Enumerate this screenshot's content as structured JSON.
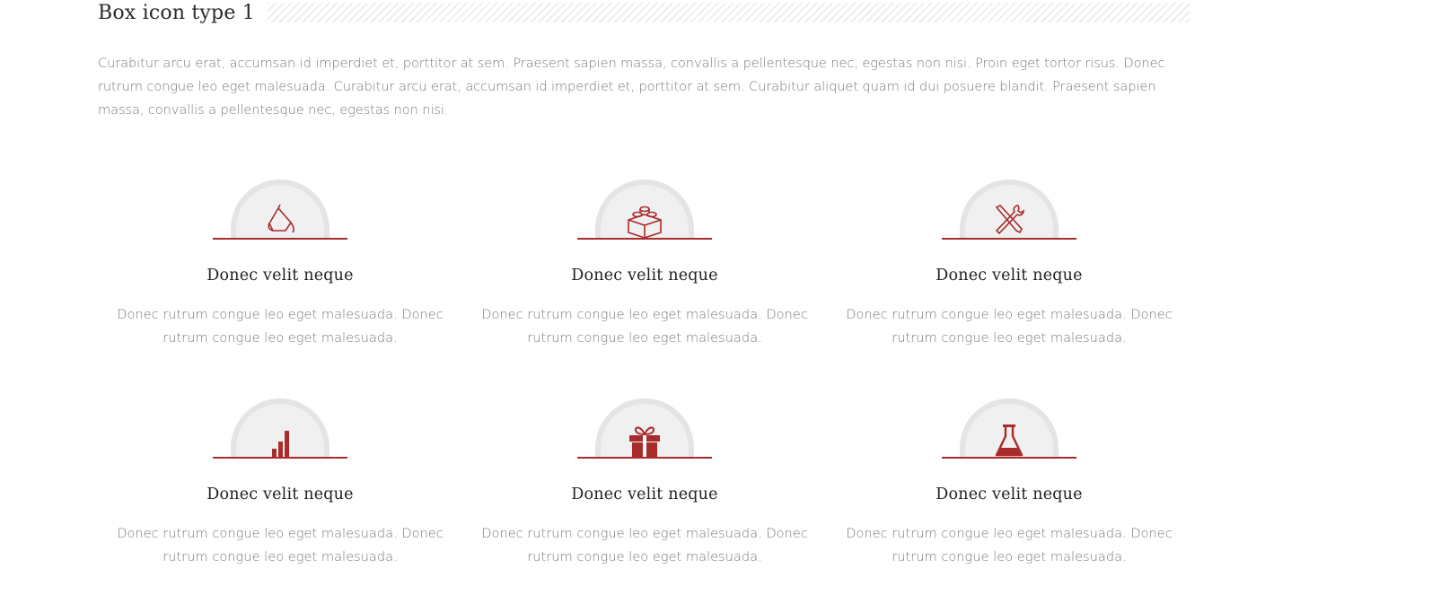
{
  "section": {
    "title": "Box icon type 1",
    "intro": "Curabitur arcu erat, accumsan id imperdiet et, porttitor at sem. Praesent sapien massa, convallis a pellentesque nec, egestas non nisi. Proin eget tortor risus. Donec rutrum congue leo eget malesuada. Curabitur arcu erat, accumsan id imperdiet et, porttitor at sem. Curabitur aliquet quam id dui posuere blandit. Praesent sapien massa, convallis a pellentesque nec, egestas non nisi."
  },
  "colors": {
    "accent": "#a92b2b",
    "circle": "#f0f0f0",
    "circle_border": "#e4e4e4",
    "text": "#7a7a7a",
    "heading": "#222222"
  },
  "boxes": [
    {
      "icon": "paint-bucket-icon",
      "title": "Donec velit neque",
      "text": "Donec rutrum congue leo eget malesuada. Donec rutrum congue leo eget malesuada."
    },
    {
      "icon": "lego-brick-icon",
      "title": "Donec velit neque",
      "text": "Donec rutrum congue leo eget malesuada. Donec rutrum congue leo eget malesuada."
    },
    {
      "icon": "tools-icon",
      "title": "Donec velit neque",
      "text": "Donec rutrum congue leo eget malesuada. Donec rutrum congue leo eget malesuada."
    },
    {
      "icon": "bar-chart-icon",
      "title": "Donec velit neque",
      "text": "Donec rutrum congue leo eget malesuada. Donec rutrum congue leo eget malesuada."
    },
    {
      "icon": "gift-icon",
      "title": "Donec velit neque",
      "text": "Donec rutrum congue leo eget malesuada. Donec rutrum congue leo eget malesuada."
    },
    {
      "icon": "flask-icon",
      "title": "Donec velit neque",
      "text": "Donec rutrum congue leo eget malesuada. Donec rutrum congue leo eget malesuada."
    }
  ]
}
